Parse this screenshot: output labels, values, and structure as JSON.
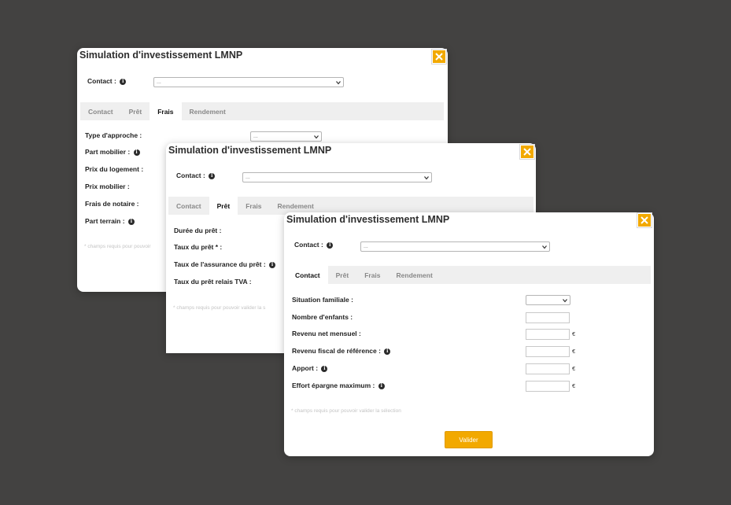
{
  "modals": [
    {
      "title": "Simulation d'investissement LMNP",
      "contact_label": "Contact :",
      "contact_value": "...",
      "tabs": [
        "Contact",
        "Prêt",
        "Frais",
        "Rendement"
      ],
      "active_tab": "Frais",
      "fields": [
        {
          "label": "Type d'approche :",
          "value": "..."
        },
        {
          "label": "Part mobilier :"
        },
        {
          "label": "Prix du logement :"
        },
        {
          "label": "Prix mobilier :"
        },
        {
          "label": "Frais de notaire :"
        },
        {
          "label": "Part terrain :"
        }
      ],
      "note": "* champs requis pour pouvoir"
    },
    {
      "title": "Simulation d'investissement LMNP",
      "contact_label": "Contact :",
      "contact_value": "...",
      "tabs": [
        "Contact",
        "Prêt",
        "Frais",
        "Rendement"
      ],
      "active_tab": "Prêt",
      "fields": [
        {
          "label": "Durée du prêt :"
        },
        {
          "label": "Taux du prêt * :"
        },
        {
          "label": "Taux de l'assurance du prêt :"
        },
        {
          "label": "Taux du prêt relais TVA :"
        }
      ],
      "note": "* champs requis pour pouvoir valider la s"
    },
    {
      "title": "Simulation d'investissement LMNP",
      "contact_label": "Contact :",
      "contact_value": "...",
      "tabs": [
        "Contact",
        "Prêt",
        "Frais",
        "Rendement"
      ],
      "active_tab": "Contact",
      "fields": [
        {
          "label": "Situation familiale :",
          "value": ""
        },
        {
          "label": "Nombre d'enfants :",
          "value": ""
        },
        {
          "label": "Revenu net mensuel :",
          "value": "",
          "unit": "€"
        },
        {
          "label": "Revenu fiscal de référence :",
          "value": "",
          "unit": "€"
        },
        {
          "label": "Apport :",
          "value": "",
          "unit": "€"
        },
        {
          "label": "Effort épargne maximum :",
          "value": "",
          "unit": "€"
        }
      ],
      "note": "* champs requis pour pouvoir valider la sélection",
      "validate_label": "Valider"
    }
  ],
  "colors": {
    "background": "#434241",
    "accent": "#f2a900",
    "tab_bar": "#efefef"
  },
  "icons": {
    "close": "close-icon",
    "info": "info-icon",
    "dropdown": "chevron-down-icon"
  }
}
